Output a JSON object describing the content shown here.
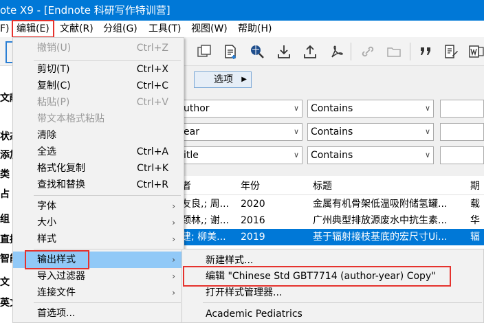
{
  "window": {
    "title": "ote X9 - [Endnote 科研写作特训营]"
  },
  "menubar": {
    "items": [
      "F)",
      "编辑(E)",
      "文献(R)",
      "分组(G)",
      "工具(T)",
      "视图(W)",
      "帮助(H)"
    ]
  },
  "toolbar": {
    "icons": [
      "copy-icon",
      "new-reference-icon",
      "online-search-icon",
      "import-icon",
      "export-icon",
      "pdf-icon",
      "link-icon",
      "folder-icon",
      "quote-icon",
      "edit-icon",
      "word-icon"
    ]
  },
  "search": {
    "options_label": "选项",
    "rows": [
      {
        "field": "uthor",
        "operator": "Contains"
      },
      {
        "field": "ear",
        "operator": "Contains"
      },
      {
        "field": "itle",
        "operator": "Contains"
      }
    ]
  },
  "results": {
    "headers": [
      "者",
      "年份",
      "标题",
      "期"
    ],
    "rows": [
      {
        "author": "友良,; 周...",
        "year": "2020",
        "title": "金属有机骨架低温吸附储氢罐...",
        "journal": "载"
      },
      {
        "author": "颈林,; 谢...",
        "year": "2016",
        "title": "广州典型排放源废水中抗生素...",
        "journal": "华"
      },
      {
        "author": "建; 柳美...",
        "year": "2019",
        "title": "基于辐射接枝基底的宏尺寸Ui...",
        "journal": "辐"
      }
    ]
  },
  "sidebar": {
    "fragments": [
      "文献",
      "状态",
      "添加",
      "类",
      "占",
      "组",
      "直播",
      "智能",
      "文",
      "英文"
    ]
  },
  "edit_menu": {
    "items": [
      {
        "label": "撤销(U)",
        "shortcut": "Ctrl+Z",
        "disabled": true
      },
      {
        "label": "剪切(T)",
        "shortcut": "Ctrl+X",
        "disabled": false
      },
      {
        "label": "复制(C)",
        "shortcut": "Ctrl+C",
        "disabled": false
      },
      {
        "label": "粘贴(P)",
        "shortcut": "Ctrl+V",
        "disabled": true
      },
      {
        "label": "带文本格式粘贴",
        "shortcut": "",
        "disabled": true
      },
      {
        "label": "清除",
        "shortcut": "",
        "disabled": false
      },
      {
        "label": "全选",
        "shortcut": "Ctrl+A",
        "disabled": false
      },
      {
        "label": "格式化复制",
        "shortcut": "Ctrl+K",
        "disabled": false
      },
      {
        "label": "查找和替换",
        "shortcut": "Ctrl+R",
        "disabled": false
      },
      {
        "label": "字体",
        "shortcut": "",
        "disabled": false
      },
      {
        "label": "大小",
        "shortcut": "",
        "disabled": false
      },
      {
        "label": "样式",
        "shortcut": "",
        "disabled": false
      },
      {
        "label": "输出样式",
        "shortcut": "",
        "disabled": false
      },
      {
        "label": "导入过滤器",
        "shortcut": "",
        "disabled": false
      },
      {
        "label": "连接文件",
        "shortcut": "",
        "disabled": false
      },
      {
        "label": "首选项...",
        "shortcut": "",
        "disabled": false
      }
    ]
  },
  "output_styles_submenu": {
    "items": [
      {
        "label": "新建样式..."
      },
      {
        "label": "编辑 \"Chinese Std GBT7714 (author-year) Copy\""
      },
      {
        "label": "打开样式管理器..."
      },
      {
        "label": "Academic Pediatrics"
      }
    ]
  },
  "colors": {
    "title_bar": "#0078d7",
    "highlight": "#91c9f7",
    "annotation": "#e5322d",
    "selection": "#0078d7"
  }
}
